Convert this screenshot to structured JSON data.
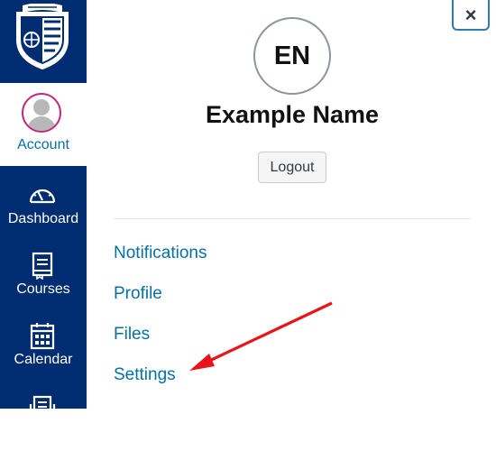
{
  "sidebar": {
    "brand_color": "#002d72",
    "logo_icon": "university-shield-logo",
    "items": [
      {
        "label": "Account",
        "icon": "account-avatar"
      },
      {
        "label": "Dashboard",
        "icon": "dashboard-icon"
      },
      {
        "label": "Courses",
        "icon": "courses-icon"
      },
      {
        "label": "Calendar",
        "icon": "calendar-icon"
      },
      {
        "label": "",
        "icon": "inbox-icon"
      }
    ]
  },
  "tray": {
    "close_icon": "close-icon",
    "close_glyph": "×",
    "avatar_initials": "EN",
    "user_name": "Example Name",
    "logout_label": "Logout",
    "links": [
      {
        "label": "Notifications"
      },
      {
        "label": "Profile"
      },
      {
        "label": "Files"
      },
      {
        "label": "Settings"
      }
    ],
    "link_color": "#0770a3",
    "annotation_arrow_color": "#e8141a"
  }
}
